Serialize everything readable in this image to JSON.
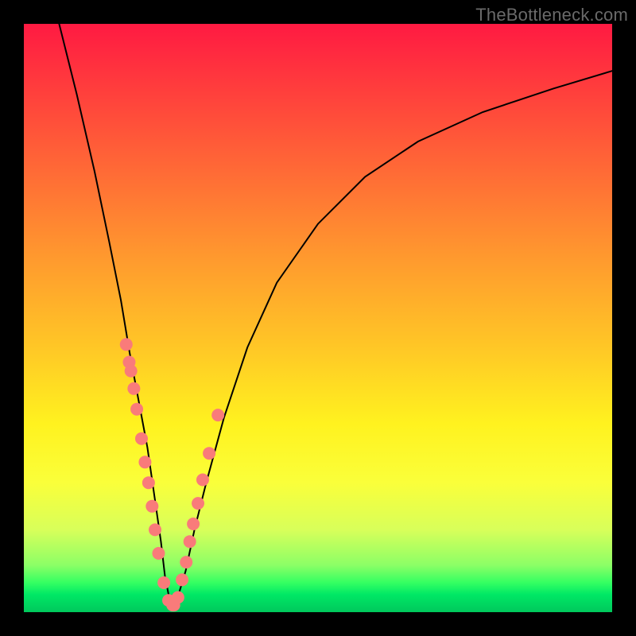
{
  "watermark": "TheBottleneck.com",
  "colors": {
    "curve_stroke": "#000000",
    "dot_fill": "#f97b7a",
    "dot_stroke": "#e36a69"
  },
  "chart_data": {
    "type": "line",
    "title": "",
    "xlabel": "",
    "ylabel": "",
    "xlim": [
      0,
      100
    ],
    "ylim": [
      0,
      100
    ],
    "series": [
      {
        "name": "bottleneck-curve",
        "x": [
          6,
          9,
          12,
          14.5,
          16.5,
          18,
          19.5,
          21,
          22.3,
          23.3,
          24,
          25,
          26,
          27.5,
          29,
          31,
          34,
          38,
          43,
          50,
          58,
          67,
          78,
          90,
          100
        ],
        "y": [
          100,
          88,
          75,
          63,
          53,
          44,
          36,
          28,
          19,
          12,
          6,
          1,
          2,
          7,
          14,
          22,
          33,
          45,
          56,
          66,
          74,
          80,
          85,
          89,
          92
        ]
      }
    ],
    "dots": {
      "name": "sample-points",
      "x": [
        17.4,
        17.9,
        18.2,
        18.7,
        19.2,
        20.0,
        20.6,
        21.2,
        21.8,
        22.3,
        22.9,
        23.8,
        24.6,
        25.3,
        25.5,
        26.2,
        26.9,
        27.6,
        28.2,
        28.8,
        29.6,
        30.4,
        31.5,
        33.0
      ],
      "y": [
        45.5,
        42.5,
        41.0,
        38.0,
        34.5,
        29.5,
        25.5,
        22.0,
        18.0,
        14.0,
        10.0,
        5.0,
        2.0,
        1.2,
        1.2,
        2.5,
        5.5,
        8.5,
        12.0,
        15.0,
        18.5,
        22.5,
        27.0,
        33.5
      ]
    }
  }
}
